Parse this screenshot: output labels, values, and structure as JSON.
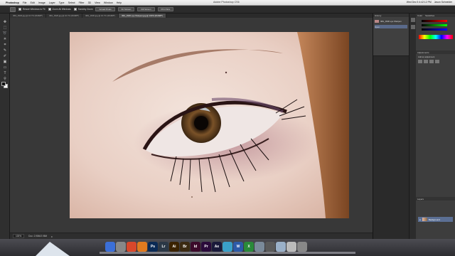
{
  "menubar": {
    "app_name": "Photoshop",
    "items": [
      "File",
      "Edit",
      "Image",
      "Layer",
      "Type",
      "Select",
      "Filter",
      "3D",
      "View",
      "Window",
      "Help"
    ],
    "window_title": "Adobe Photoshop CS6",
    "status_time": "Wed Dec 5 4:42:12 PM",
    "user": "Jason Schneider"
  },
  "options": {
    "check1_label": "Resize Windows to Fit",
    "check2_label": "Zoom All Windows",
    "check3_label": "Scrubby Zoom",
    "btn1": "Actual Pixels",
    "btn2": "Fit Screen",
    "btn3": "Fill Screen",
    "btn4": "Print Size"
  },
  "tabs": [
    {
      "label": "IMG_9329.jpg @ 16.7% (RGB/8*)",
      "active": false
    },
    {
      "label": "IMG_9326.jpg @ 16.7% (RGB/8*)",
      "active": false
    },
    {
      "label": "IMG_9330.jpg @ 16.7% (RGB/8*)",
      "active": false
    },
    {
      "label": "IMG_9330 eye Sharpen.jpg @ 100% (RGB/8*)",
      "active": true
    }
  ],
  "status": {
    "zoom": "100%",
    "doc": "Doc: 2.98M/2.98M",
    "mini_label": "Timeline"
  },
  "panels": {
    "history_title": "History",
    "history_items": [
      {
        "label": "IMG_9330 eye Sharpen",
        "selected": false
      },
      {
        "label": "Open",
        "selected": true
      }
    ],
    "color_title": "Color",
    "swatches_title": "Swatches",
    "adjust_title": "Adjustments",
    "adjust_sub": "Add an adjustment",
    "layers_title": "Layers",
    "layer_name": "Background"
  },
  "dock_icons": [
    {
      "label": "",
      "color": "#3b6fd8"
    },
    {
      "label": "",
      "color": "#888888"
    },
    {
      "label": "",
      "color": "#d9482b"
    },
    {
      "label": "",
      "color": "#e07a1f"
    },
    {
      "label": "Ps",
      "color": "#0a2a55"
    },
    {
      "label": "Lr",
      "color": "#2b3846"
    },
    {
      "label": "Ai",
      "color": "#3a2200"
    },
    {
      "label": "Br",
      "color": "#3b2a12"
    },
    {
      "label": "Id",
      "color": "#3b0a2a"
    },
    {
      "label": "Pr",
      "color": "#2a0a3a"
    },
    {
      "label": "Ae",
      "color": "#1a1a3a"
    },
    {
      "label": "",
      "color": "#3aa0c8"
    },
    {
      "label": "W",
      "color": "#2d5aa8"
    },
    {
      "label": "X",
      "color": "#2a8a3a"
    },
    {
      "label": "",
      "color": "#7a8a9a"
    },
    {
      "label": "",
      "color": "#5a5a5a"
    },
    {
      "label": "",
      "color": "#9ab0c8"
    },
    {
      "label": "",
      "color": "#bbbbbb"
    },
    {
      "label": "",
      "color": "#888888"
    }
  ]
}
